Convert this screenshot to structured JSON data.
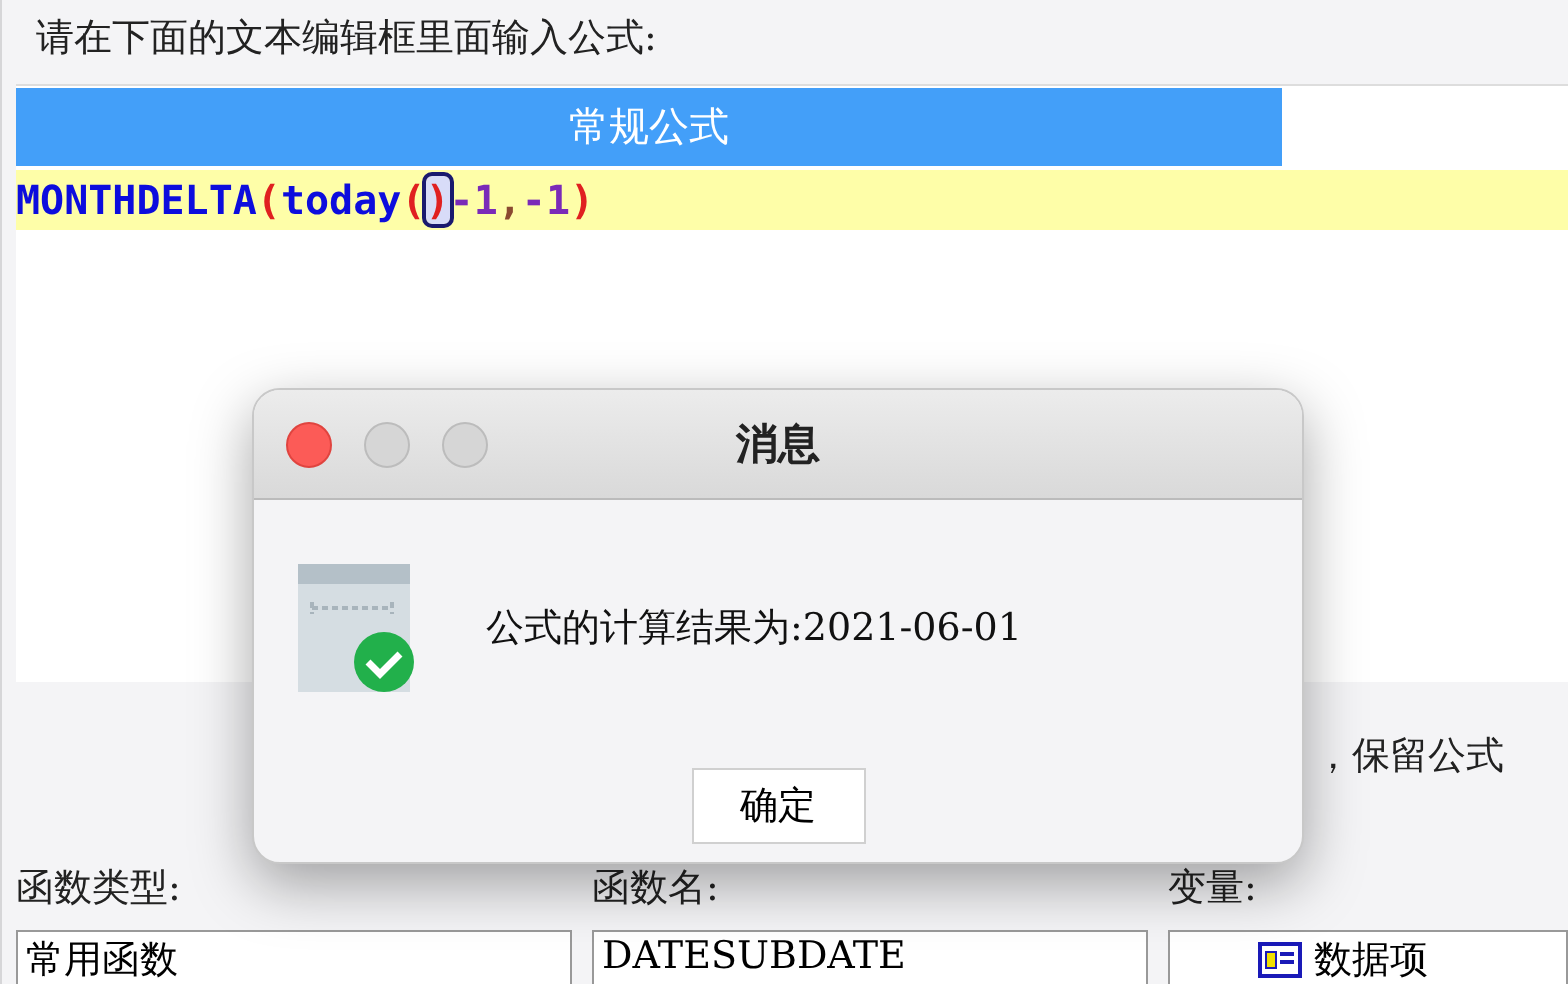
{
  "prompt": "请在下面的文本编辑框里面输入公式:",
  "editor": {
    "tab": {
      "label": "常规公式",
      "selected": true
    },
    "tokens": [
      {
        "text": "MONTHDELTA",
        "kind": "function",
        "highlighted": false
      },
      {
        "text": "(",
        "kind": "paren",
        "highlighted": false
      },
      {
        "text": "today",
        "kind": "function",
        "highlighted": false
      },
      {
        "text": "(",
        "kind": "paren",
        "highlighted": false
      },
      {
        "text": ")",
        "kind": "paren",
        "highlighted": true
      },
      {
        "text": "-1",
        "kind": "number",
        "highlighted": false
      },
      {
        "text": ",",
        "kind": "comma",
        "highlighted": false
      },
      {
        "text": "-1",
        "kind": "number",
        "highlighted": false
      },
      {
        "text": ")",
        "kind": "paren",
        "highlighted": false
      }
    ]
  },
  "note_fragment": "，保留公式",
  "lists": [
    {
      "label": "函数类型:",
      "first_item": "常用函数",
      "icon": false
    },
    {
      "label": "函数名:",
      "first_item": "DATESUBDATE",
      "icon": false
    },
    {
      "label": "变量:",
      "first_item": "数据项",
      "icon": true
    }
  ],
  "dialog": {
    "title": "消息",
    "message": "公式的计算结果为:2021-06-01",
    "button": "确定"
  }
}
